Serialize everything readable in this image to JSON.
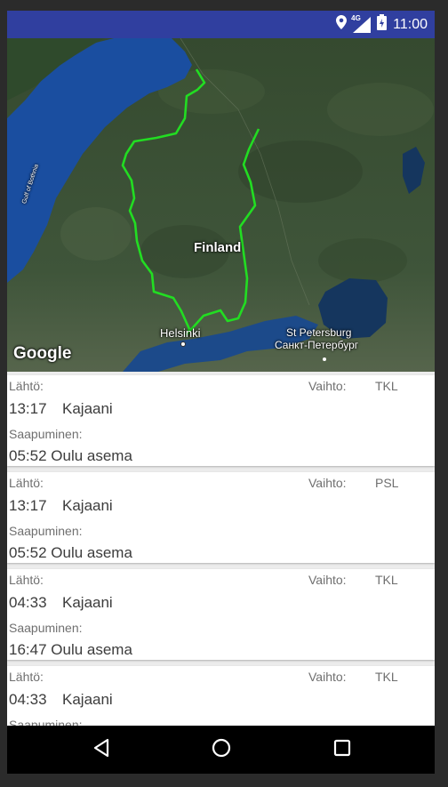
{
  "status_bar": {
    "time": "11:00",
    "network": "4G",
    "icons": [
      "location-pin-icon",
      "signal-icon",
      "battery-icon"
    ]
  },
  "map": {
    "country_label": "Finland",
    "city_helsinki": "Helsinki",
    "city_stpetersburg": "St Petersburg",
    "city_stpetersburg_cyr": "Санкт-Петербург",
    "gulf_label": "Gulf of Bothnia",
    "logo": "Google",
    "route_color": "#22dd22"
  },
  "labels": {
    "departure": "Lähtö:",
    "transfer": "Vaihto:",
    "arrival": "Saapuminen:"
  },
  "connections": [
    {
      "transfer_code": "TKL",
      "departure_time": "13:17",
      "departure_station": "Kajaani",
      "arrival": "05:52 Oulu asema"
    },
    {
      "transfer_code": "PSL",
      "departure_time": "13:17",
      "departure_station": "Kajaani",
      "arrival": "05:52 Oulu asema"
    },
    {
      "transfer_code": "TKL",
      "departure_time": "04:33",
      "departure_station": "Kajaani",
      "arrival": "16:47 Oulu asema"
    },
    {
      "transfer_code": "TKL",
      "departure_time": "04:33",
      "departure_station": "Kajaani",
      "arrival": "Saapuminen:"
    }
  ],
  "nav": {
    "icons": [
      "back-icon",
      "home-icon",
      "recents-icon"
    ]
  }
}
